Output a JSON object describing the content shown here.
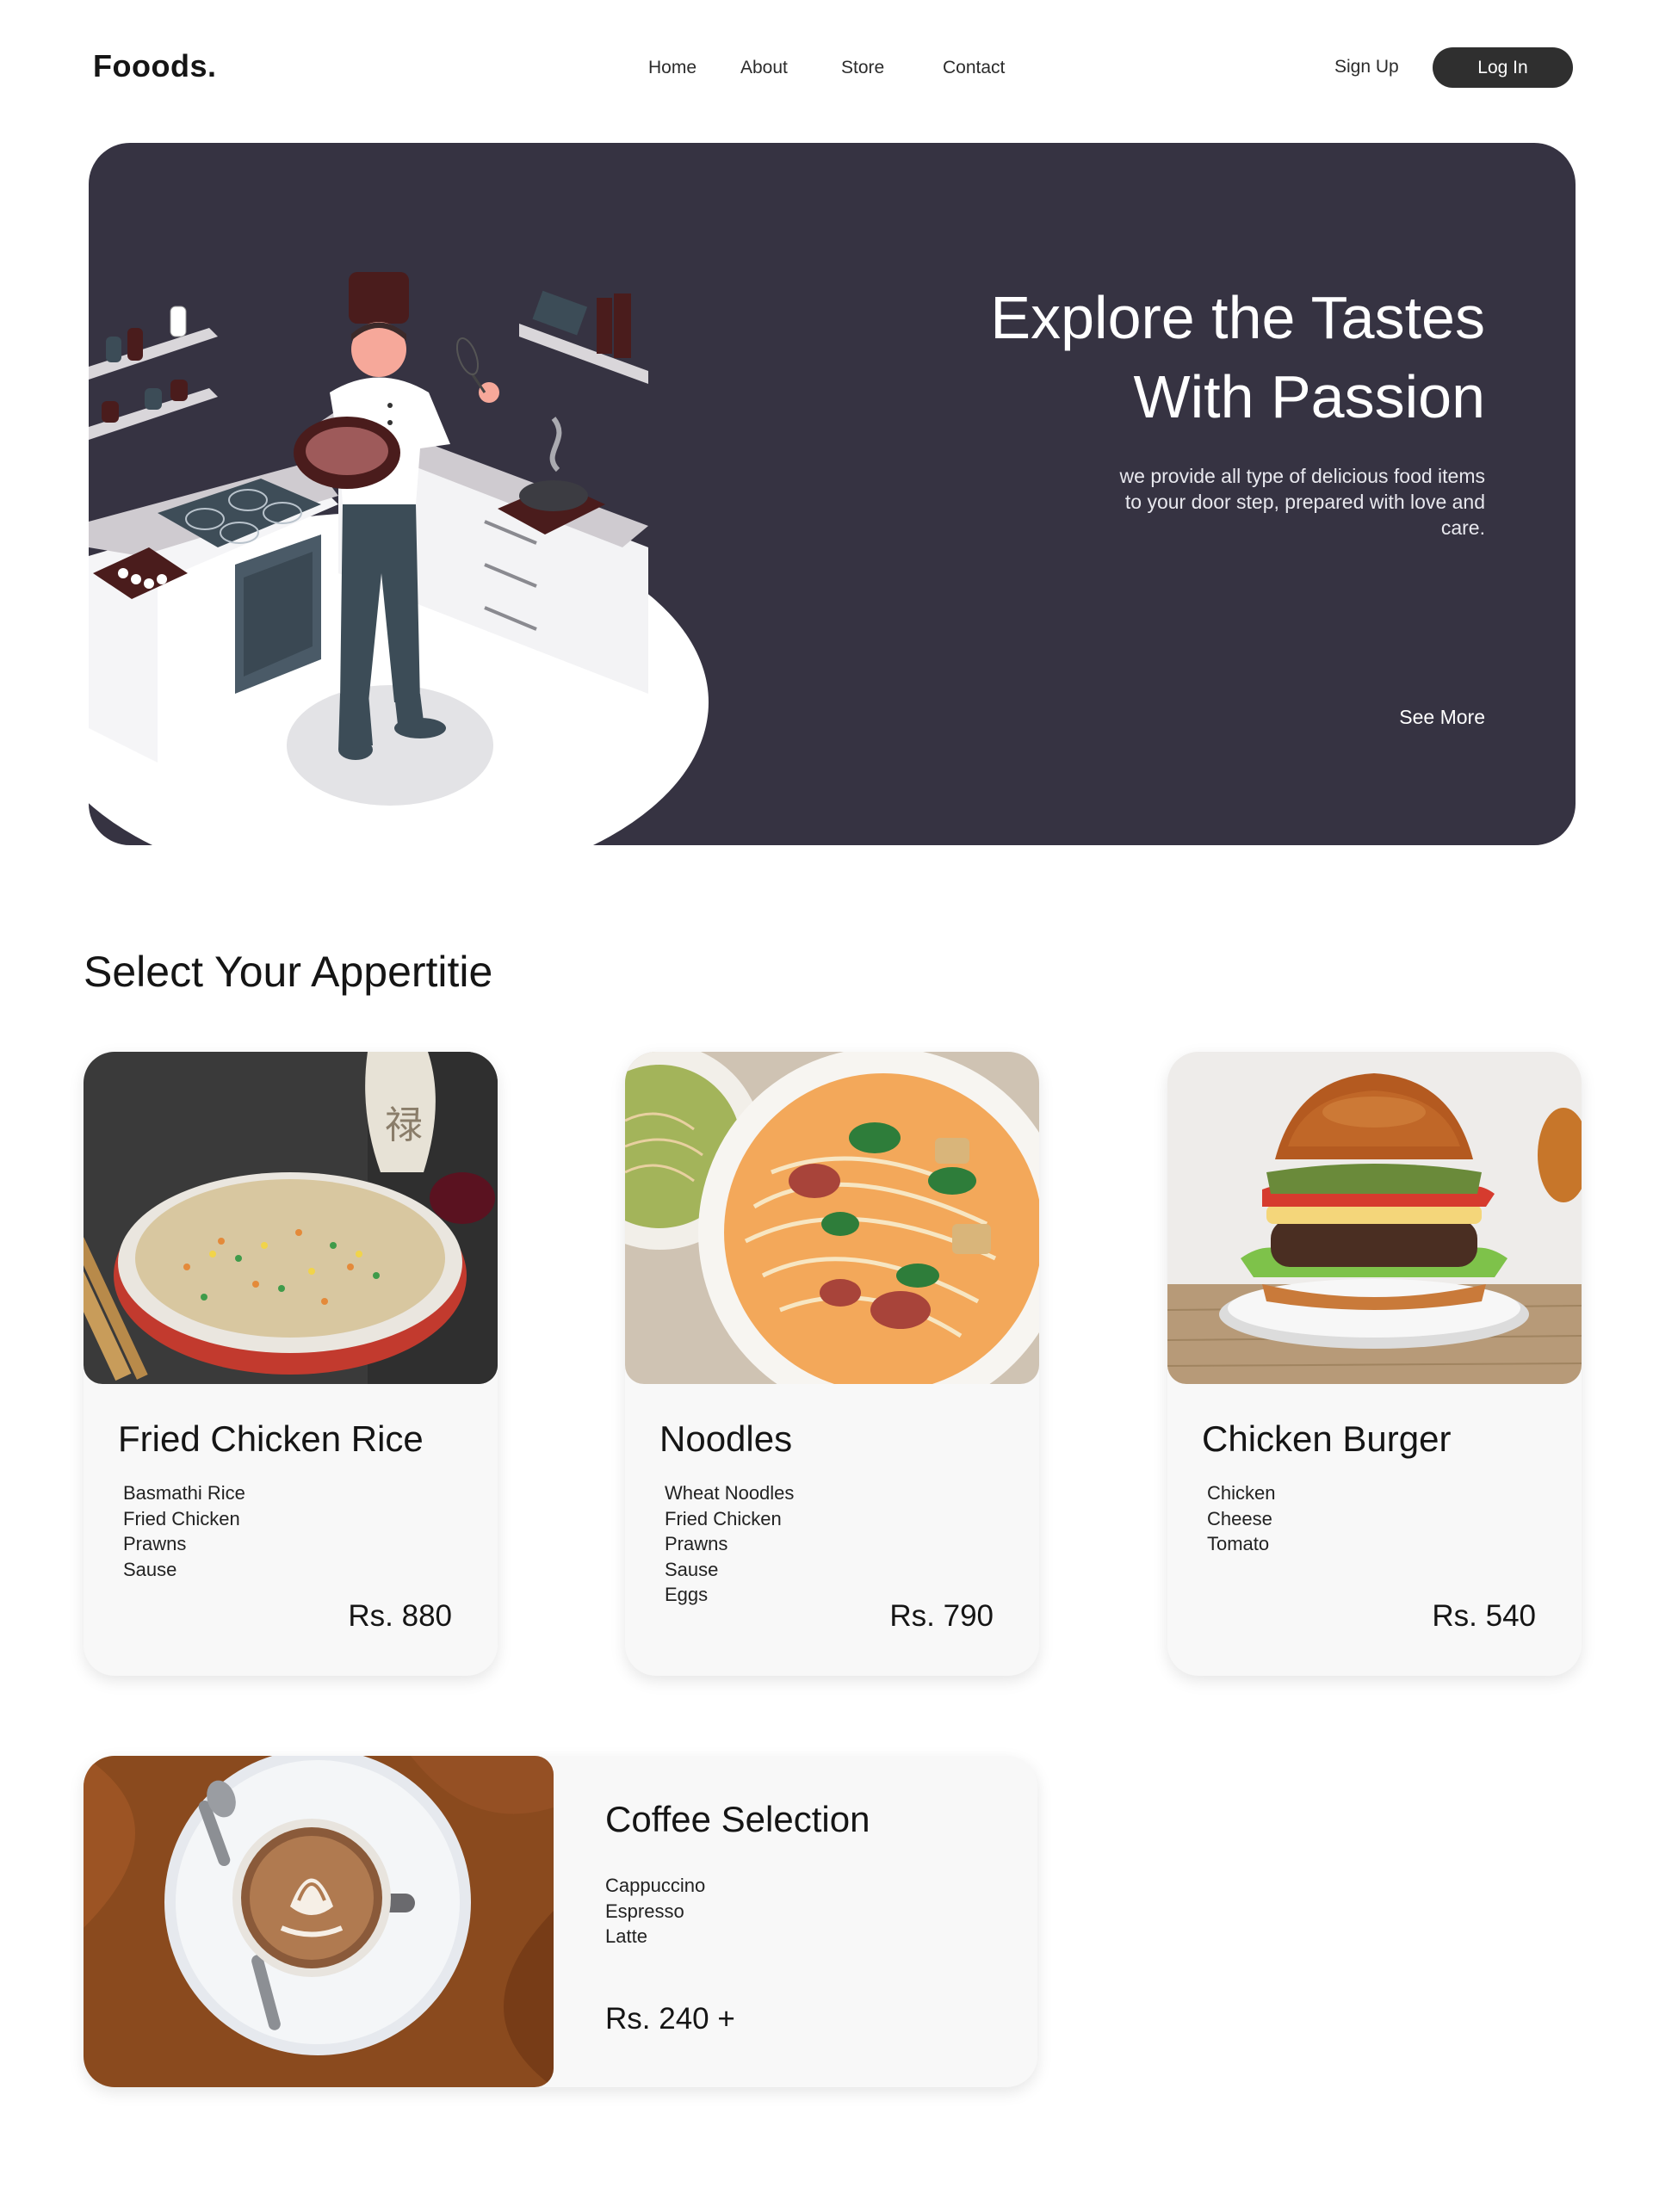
{
  "brand": {
    "logo": "Fooods."
  },
  "nav": {
    "links": [
      "Home",
      "About",
      "Store",
      "Contact"
    ],
    "signup": "Sign Up",
    "login": "Log In"
  },
  "hero": {
    "title_line1": "Explore the Tastes",
    "title_line2": "With Passion",
    "description": "we provide all type of delicious food items to your door step, prepared with love and care.",
    "cta": "See More",
    "background_color": "#363342"
  },
  "section": {
    "title": "Select Your Appertitie"
  },
  "cards": [
    {
      "title": "Fried Chicken Rice",
      "ingredients": [
        "Basmathi Rice",
        "Fried Chicken",
        "Prawns",
        "Sause"
      ],
      "price": "Rs. 880"
    },
    {
      "title": "Noodles",
      "ingredients": [
        "Wheat Noodles",
        "Fried Chicken",
        "Prawns",
        "Sause",
        "Eggs"
      ],
      "price": "Rs. 790"
    },
    {
      "title": "Chicken Burger",
      "ingredients": [
        "Chicken",
        "Cheese",
        "Tomato"
      ],
      "price": "Rs. 540"
    }
  ],
  "coffee": {
    "title": "Coffee Selection",
    "items": [
      "Cappuccino",
      "Espresso",
      "Latte"
    ],
    "price": "Rs. 240 +"
  }
}
